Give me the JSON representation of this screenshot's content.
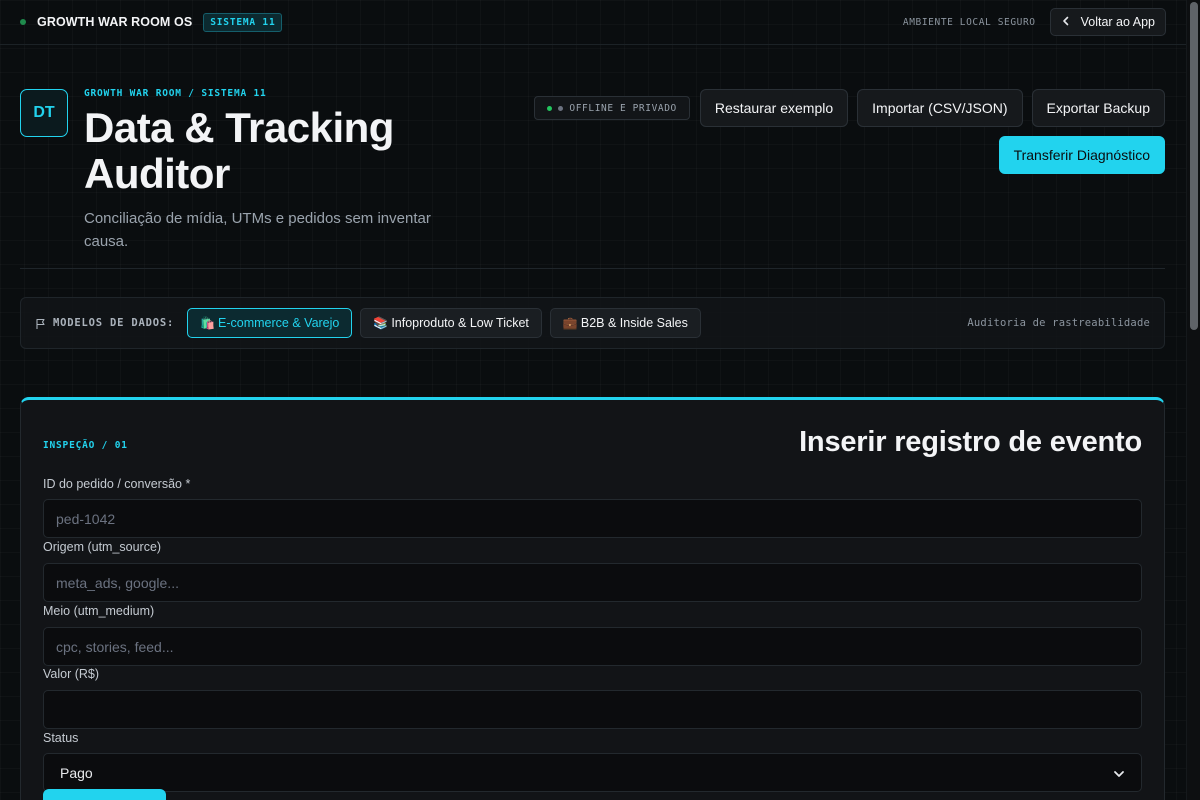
{
  "topbar": {
    "brand": "GROWTH WAR ROOM OS",
    "system_badge": "SISTEMA 11",
    "environment": "AMBIENTE LOCAL SEGURO",
    "back_button": "Voltar ao App"
  },
  "header": {
    "logo_initials": "DT",
    "breadcrumb": "GROWTH WAR ROOM / SISTEMA 11",
    "title_line1": "Data & Tracking",
    "title_line2": "Auditor",
    "subtitle": "Conciliação de mídia, UTMs e pedidos sem inventar causa.",
    "status_pill": "OFFLINE E PRIVADO",
    "actions": {
      "restore": "Restaurar exemplo",
      "import": "Importar (CSV/JSON)",
      "export": "Exportar Backup",
      "transfer": "Transferir Diagnóstico"
    }
  },
  "models": {
    "label": "MODELOS DE DADOS:",
    "items": [
      {
        "emoji": "🛍️",
        "label": "E-commerce & Varejo",
        "active": true
      },
      {
        "emoji": "📚",
        "label": "Infoproduto & Low Ticket",
        "active": false
      },
      {
        "emoji": "💼",
        "label": "B2B & Inside Sales",
        "active": false
      }
    ],
    "right_label": "Auditoria de rastreabilidade"
  },
  "form": {
    "section_label": "INSPEÇÃO / 01",
    "title": "Inserir registro de evento",
    "fields": {
      "order_id": {
        "label": "ID do pedido / conversão *",
        "placeholder": "ped-1042",
        "value": ""
      },
      "source": {
        "label": "Origem (utm_source)",
        "placeholder": "meta_ads, google...",
        "value": ""
      },
      "medium": {
        "label": "Meio (utm_medium)",
        "placeholder": "cpc, stories, feed...",
        "value": ""
      },
      "amount": {
        "label": "Valor (R$)",
        "placeholder": "",
        "value": ""
      },
      "status": {
        "label": "Status",
        "selected": "Pago"
      }
    }
  },
  "colors": {
    "accent": "#22d3ee",
    "background": "#0a0d0f",
    "status_online": "#22c55e"
  }
}
